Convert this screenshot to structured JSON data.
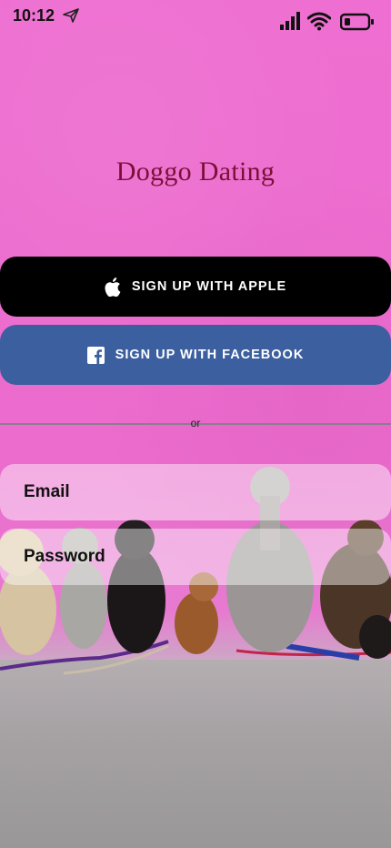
{
  "status_bar": {
    "time": "10:12",
    "icons": [
      "send-icon",
      "signal-icon",
      "wifi-icon",
      "battery-icon"
    ]
  },
  "app": {
    "title": "Doggo Dating"
  },
  "buttons": {
    "apple_label": "SIGN UP WITH APPLE",
    "facebook_label": "SIGN UP WITH FACEBOOK"
  },
  "divider": {
    "text": "or"
  },
  "form": {
    "email_label": "Email",
    "password_label": "Password"
  },
  "colors": {
    "background_pink": "#ee6fd1",
    "title_color": "#7a1038",
    "apple_button": "#000000",
    "facebook_button": "#3b5f9f"
  }
}
